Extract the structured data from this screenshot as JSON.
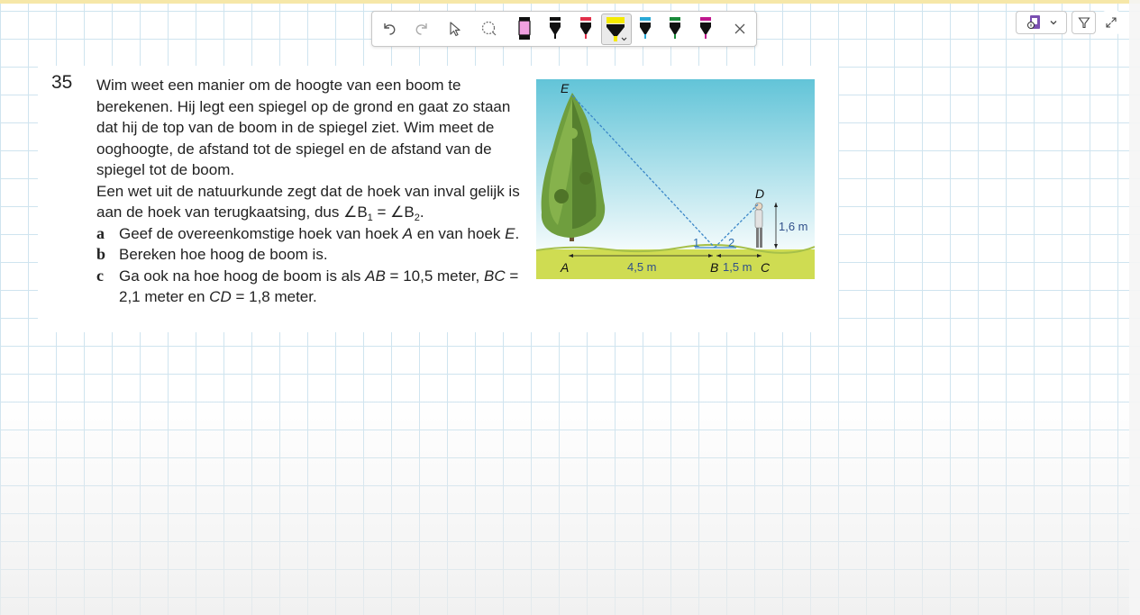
{
  "toolbar": {
    "buttons": [
      {
        "icon": "undo-icon"
      },
      {
        "icon": "redo-icon"
      },
      {
        "icon": "select-cursor-icon"
      },
      {
        "icon": "lasso-icon"
      },
      {
        "icon": "pen-icon",
        "color": "#f0a0e0"
      },
      {
        "icon": "pen-icon",
        "color": "#111111"
      },
      {
        "icon": "pen-icon",
        "color": "#e2304a"
      },
      {
        "icon": "highlighter-icon",
        "color": "#f4ea00",
        "selected": true
      },
      {
        "icon": "pen-icon",
        "color": "#2aa9d6"
      },
      {
        "icon": "pen-icon",
        "color": "#1a8a3a"
      },
      {
        "icon": "pen-icon",
        "color": "#c0188e"
      },
      {
        "icon": "close-icon"
      }
    ]
  },
  "view_controls": {
    "notebook_icon": "notebook-icon",
    "filter_icon": "filter-icon",
    "expand_icon": "expand-icon"
  },
  "exercise": {
    "number": "35",
    "intro": "Wim weet een manier om de hoogte van een boom te berekenen. Hij legt een spiegel op de grond en gaat zo staan dat hij de top van de boom in de spiegel ziet. Wim meet de ooghoogte, de afstand tot de spiegel en de afstand van de spiegel tot de boom.",
    "law_text": "Een wet uit de natuurkunde zegt dat de hoek van inval gelijk is aan de hoek van terugkaatsing, dus ∠B",
    "law_sub1": "1",
    "law_eq": " = ∠B",
    "law_sub2": "2",
    "law_end": ".",
    "items": [
      {
        "label": "a",
        "text_pre": "Geef de overeenkomstige hoek van hoek ",
        "var1": "A",
        "text_mid": " en van hoek ",
        "var2": "E",
        "text_end": "."
      },
      {
        "label": "b",
        "text": "Bereken hoe hoog de boom is."
      },
      {
        "label": "c",
        "text_pre": "Ga ook na hoe hoog de boom is als ",
        "v1": "AB",
        "t1": " = 10,5 meter, ",
        "v2": "BC",
        "t2": " = 2,1 meter en ",
        "v3": "CD",
        "t3": " = 1,8 meter."
      }
    ]
  },
  "figure": {
    "points": {
      "E": "E",
      "D": "D",
      "A": "A",
      "B": "B",
      "C": "C"
    },
    "angle1": "1",
    "angle2": "2",
    "dist_AB": "4,5 m",
    "dist_BC": "1,5 m",
    "height_CD": "1,6 m",
    "colors": {
      "sky_top": "#62c4d8",
      "sky_bottom": "#f4fbfc",
      "grass": "#cfdc52",
      "line": "#3a86c8"
    }
  }
}
